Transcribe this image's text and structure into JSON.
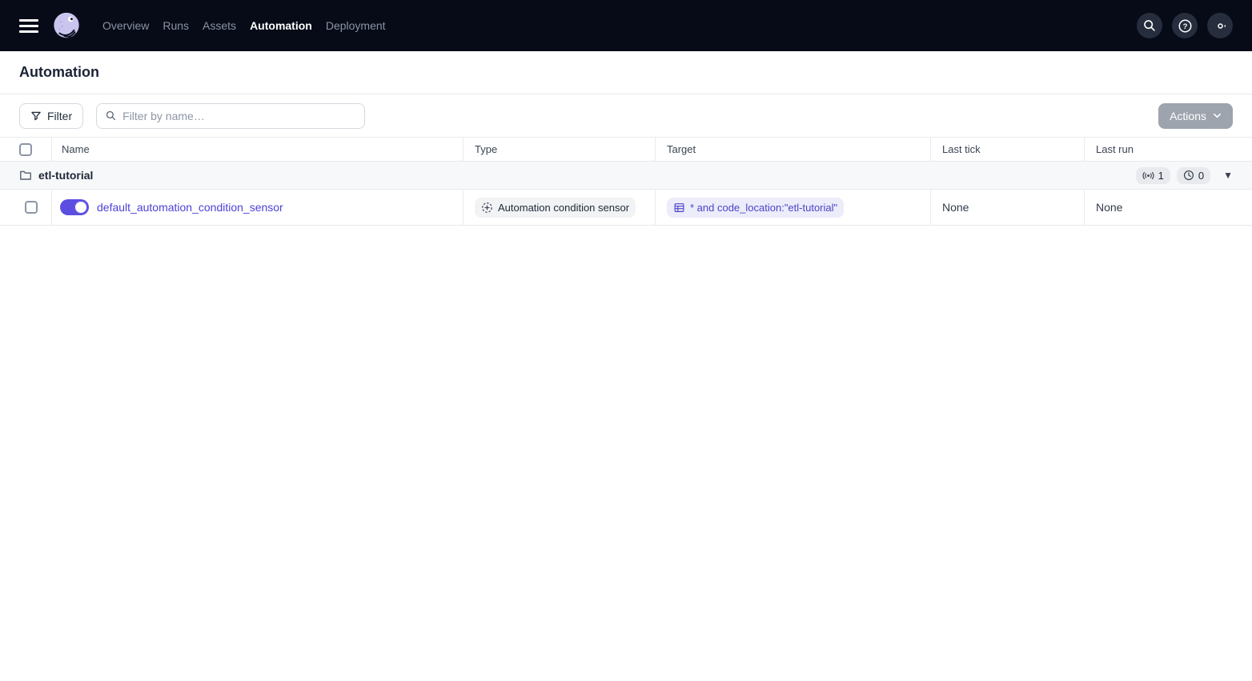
{
  "nav": {
    "items": [
      {
        "label": "Overview",
        "active": false
      },
      {
        "label": "Runs",
        "active": false
      },
      {
        "label": "Assets",
        "active": false
      },
      {
        "label": "Automation",
        "active": true
      },
      {
        "label": "Deployment",
        "active": false
      }
    ],
    "right_icons": [
      "search-icon",
      "help-icon",
      "settings-icon"
    ]
  },
  "page": {
    "title": "Automation"
  },
  "toolbar": {
    "filter_button": "Filter",
    "search_placeholder": "Filter by name…",
    "actions_button": "Actions"
  },
  "table": {
    "columns": {
      "name": "Name",
      "type": "Type",
      "target": "Target",
      "last_tick": "Last tick",
      "last_run": "Last run"
    },
    "group": {
      "name": "etl-tutorial",
      "sensor_count": "1",
      "schedule_count": "0"
    },
    "rows": [
      {
        "name": "default_automation_condition_sensor",
        "enabled": true,
        "type": "Automation condition sensor",
        "target": "* and code_location:\"etl-tutorial\"",
        "last_tick": "None",
        "last_run": "None"
      }
    ]
  },
  "colors": {
    "nav_background": "#070B18",
    "accent_indigo": "#5B4EE0",
    "link_indigo": "#4B43D6",
    "target_pill_bg": "#ECECFA",
    "group_row_bg": "#F7F8FA",
    "disabled_button": "#9EA4AE",
    "border": "#E8EAEE"
  }
}
